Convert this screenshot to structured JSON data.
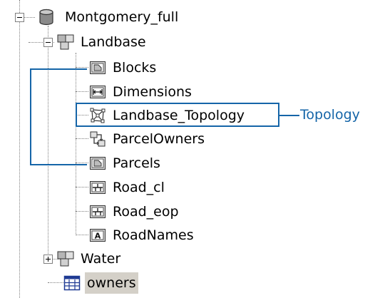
{
  "tree": {
    "root": {
      "label": "Montgomery_full",
      "icon": "database-cylinder-icon",
      "state": "expanded"
    },
    "landbase": {
      "label": "Landbase",
      "icon": "feature-dataset-icon",
      "state": "expanded"
    },
    "items": [
      {
        "label": "Blocks",
        "icon": "polygon-feature-class-icon"
      },
      {
        "label": "Dimensions",
        "icon": "dimension-feature-class-icon"
      },
      {
        "label": "Landbase_Topology",
        "icon": "topology-icon"
      },
      {
        "label": "ParcelOwners",
        "icon": "relationship-class-icon"
      },
      {
        "label": "Parcels",
        "icon": "polygon-feature-class-icon"
      },
      {
        "label": "Road_cl",
        "icon": "line-feature-class-icon"
      },
      {
        "label": "Road_eop",
        "icon": "line-feature-class-icon"
      },
      {
        "label": "RoadNames",
        "icon": "annotation-feature-class-icon"
      }
    ],
    "water": {
      "label": "Water",
      "icon": "feature-dataset-icon",
      "state": "collapsed"
    },
    "owners": {
      "label": "owners",
      "icon": "table-icon",
      "selected": true
    }
  },
  "callout": {
    "text": "Topology"
  },
  "colors": {
    "accent": "#1565a8",
    "selection": "#d4d0c8",
    "tree_line": "#7f7f7f"
  }
}
